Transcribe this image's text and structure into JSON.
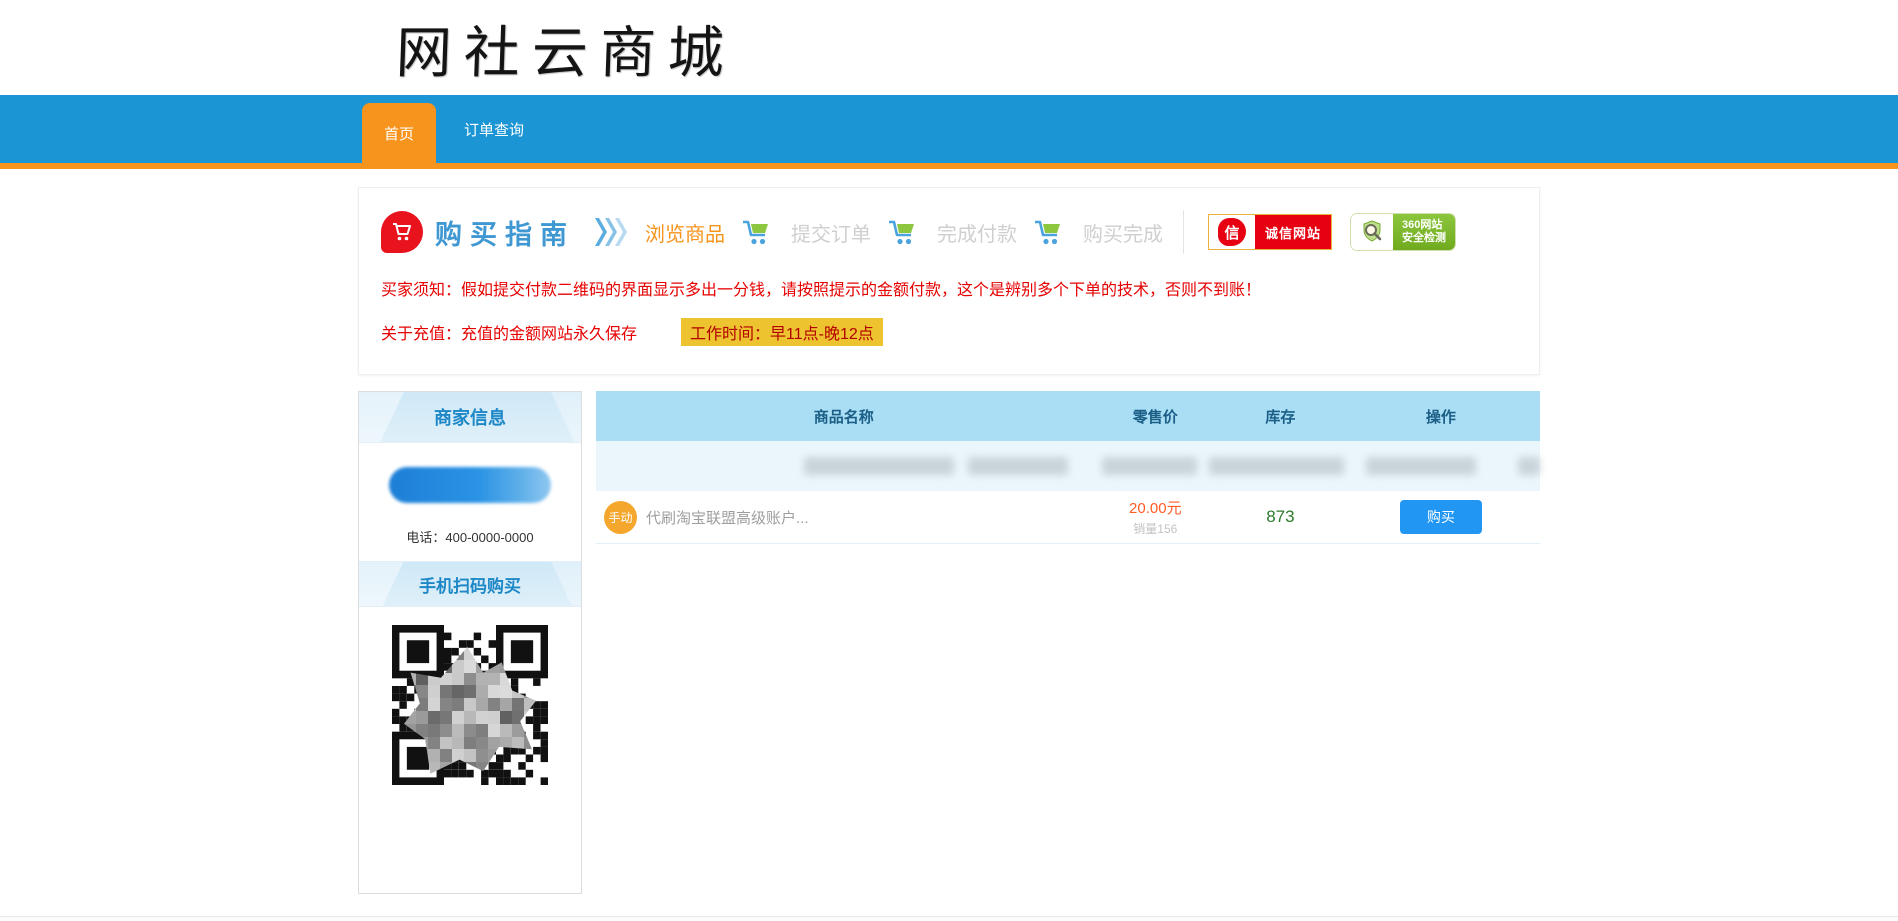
{
  "site": {
    "logo_text": "网社云商城"
  },
  "nav": {
    "tabs": [
      {
        "label": "首页",
        "active": true
      },
      {
        "label": "订单查询",
        "active": false
      }
    ]
  },
  "guide": {
    "title": "购买指南",
    "steps": [
      {
        "label": "浏览商品",
        "state": "active"
      },
      {
        "label": "提交订单",
        "state": "inactive"
      },
      {
        "label": "完成付款",
        "state": "inactive"
      },
      {
        "label": "购买完成",
        "state": "inactive"
      }
    ],
    "badges": {
      "credit": {
        "char": "信",
        "label": "诚信网站"
      },
      "safe360": {
        "line1": "360网站",
        "line2": "安全检测"
      }
    },
    "notice_line1": "买家须知：假如提交付款二维码的界面显示多出一分钱，请按照提示的金额付款，这个是辨别多个下单的技术，否则不到账！",
    "notice_line2": "关于充值：充值的金额网站永久保存",
    "work_hours": "工作时间：早11点-晚12点"
  },
  "sidebar": {
    "merchant_title": "商家信息",
    "phone_label": "电话：400-0000-0000",
    "qr_title": "手机扫码购买"
  },
  "table": {
    "headers": [
      "商品名称",
      "零售价",
      "库存",
      "操作"
    ],
    "rows": [
      {
        "badge": "手动",
        "name": "代刷淘宝联盟高级账户...",
        "price": "20.00元",
        "sales": "销量156",
        "stock": "873",
        "action": "购买"
      }
    ]
  },
  "colors": {
    "nav_blue": "#1b95d4",
    "accent_orange": "#f7941d",
    "notice_red": "#e60000",
    "highlight_yellow": "#edc32f",
    "table_header_blue": "#a9def5",
    "price_orange": "#ff5c26",
    "stock_green": "#2d7a2d",
    "buy_blue": "#2196f3"
  }
}
